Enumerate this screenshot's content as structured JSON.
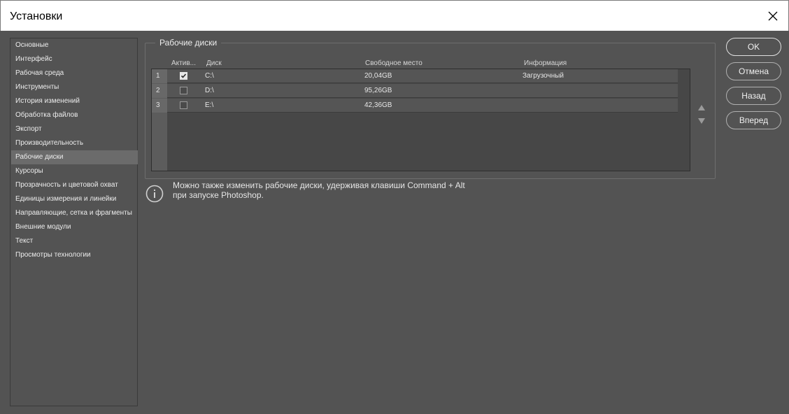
{
  "window": {
    "title": "Установки"
  },
  "sidebar": {
    "items": [
      {
        "label": "Основные"
      },
      {
        "label": "Интерфейс"
      },
      {
        "label": "Рабочая среда"
      },
      {
        "label": "Инструменты"
      },
      {
        "label": "История изменений"
      },
      {
        "label": "Обработка файлов"
      },
      {
        "label": "Экспорт"
      },
      {
        "label": "Производительность"
      },
      {
        "label": "Рабочие диски",
        "selected": true
      },
      {
        "label": "Курсоры"
      },
      {
        "label": "Прозрачность и цветовой охват"
      },
      {
        "label": "Единицы измерения и линейки"
      },
      {
        "label": "Направляющие, сетка и фрагменты"
      },
      {
        "label": "Внешние модули"
      },
      {
        "label": "Текст"
      },
      {
        "label": "Просмотры технологии"
      }
    ]
  },
  "scratch": {
    "group_title": "Рабочие диски",
    "columns": {
      "active": "Актив...",
      "disk": "Диск",
      "free": "Свободное место",
      "info": "Информация"
    },
    "rows": [
      {
        "num": "1",
        "active": true,
        "disk": "C:\\",
        "free": "20,04GB",
        "info": "Загрузочный"
      },
      {
        "num": "2",
        "active": false,
        "disk": "D:\\",
        "free": "95,26GB",
        "info": ""
      },
      {
        "num": "3",
        "active": false,
        "disk": "E:\\",
        "free": "42,36GB",
        "info": ""
      }
    ]
  },
  "info": {
    "line1": "Можно также изменить рабочие диски, удерживая клавиши Command + Alt",
    "line2": "при запуске Photoshop."
  },
  "buttons": {
    "ok": "OK",
    "cancel": "Отмена",
    "back": "Назад",
    "forward": "Вперед"
  },
  "icons": {
    "close": "close-icon",
    "info": "info-icon",
    "move_up": "triangle-up-icon",
    "move_down": "triangle-down-icon",
    "check": "checkmark-icon"
  }
}
